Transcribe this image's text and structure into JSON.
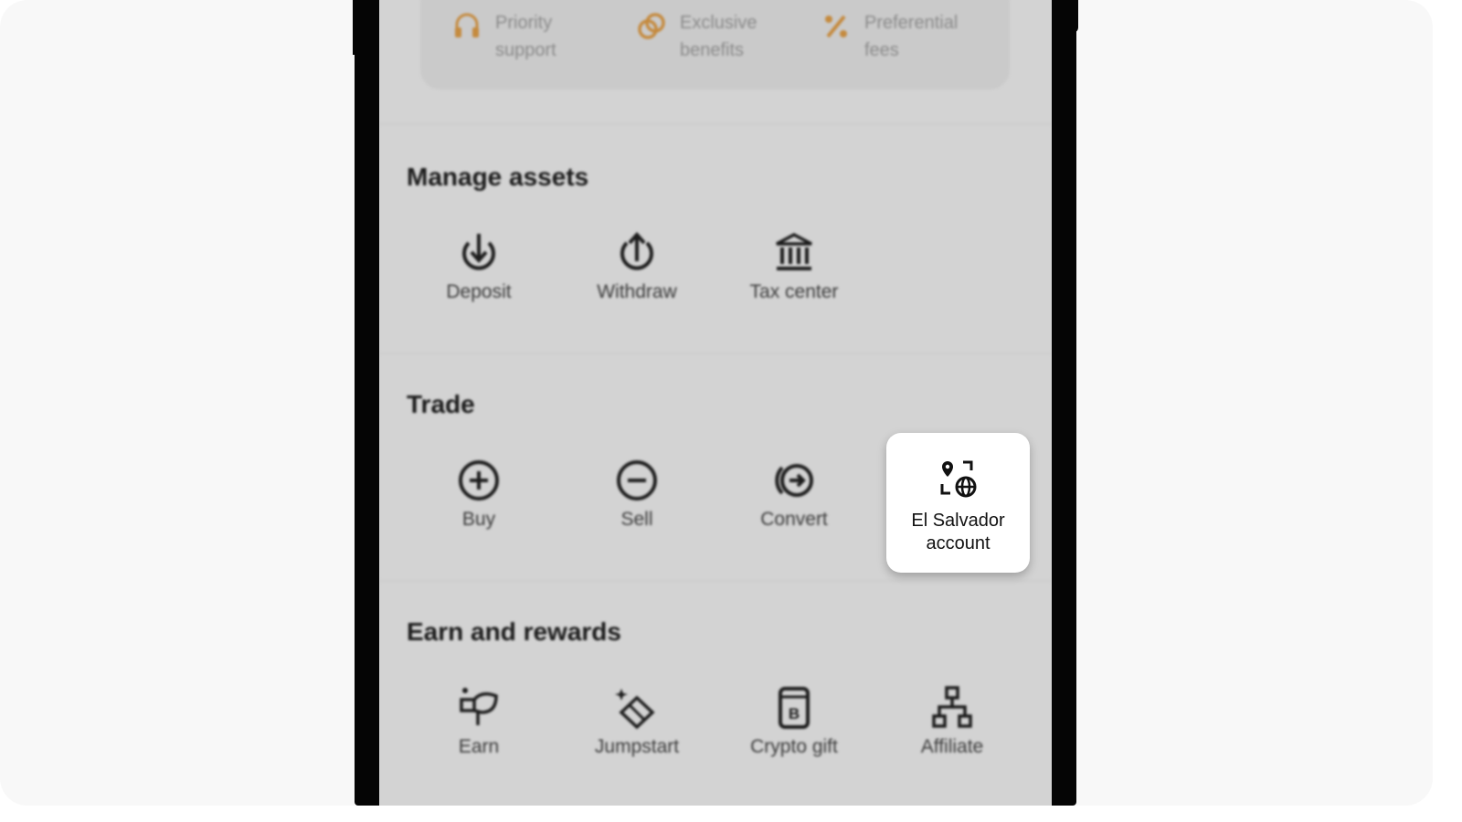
{
  "vip": {
    "items": [
      {
        "label": "Priority support",
        "icon": "headset-icon"
      },
      {
        "label": "Exclusive benefits",
        "icon": "coins-icon"
      },
      {
        "label": "Preferential fees",
        "icon": "percent-icon"
      }
    ],
    "accent": "#c58a3e"
  },
  "sections": {
    "manage": {
      "title": "Manage assets",
      "items": [
        {
          "label": "Deposit",
          "icon": "deposit-icon"
        },
        {
          "label": "Withdraw",
          "icon": "withdraw-icon"
        },
        {
          "label": "Tax center",
          "icon": "bank-icon"
        }
      ]
    },
    "trade": {
      "title": "Trade",
      "items": [
        {
          "label": "Buy",
          "icon": "plus-circle-icon"
        },
        {
          "label": "Sell",
          "icon": "minus-circle-icon"
        },
        {
          "label": "Convert",
          "icon": "convert-icon"
        }
      ],
      "highlight": {
        "label_line1": "El Salvador",
        "label_line2": "account",
        "icon": "location-globe-icon"
      }
    },
    "earn": {
      "title": "Earn and rewards",
      "items": [
        {
          "label": "Earn",
          "icon": "earn-icon"
        },
        {
          "label": "Jumpstart",
          "icon": "jumpstart-icon"
        },
        {
          "label": "Crypto gift",
          "icon": "gift-card-icon"
        },
        {
          "label": "Affiliate",
          "icon": "affiliate-icon"
        }
      ]
    }
  }
}
